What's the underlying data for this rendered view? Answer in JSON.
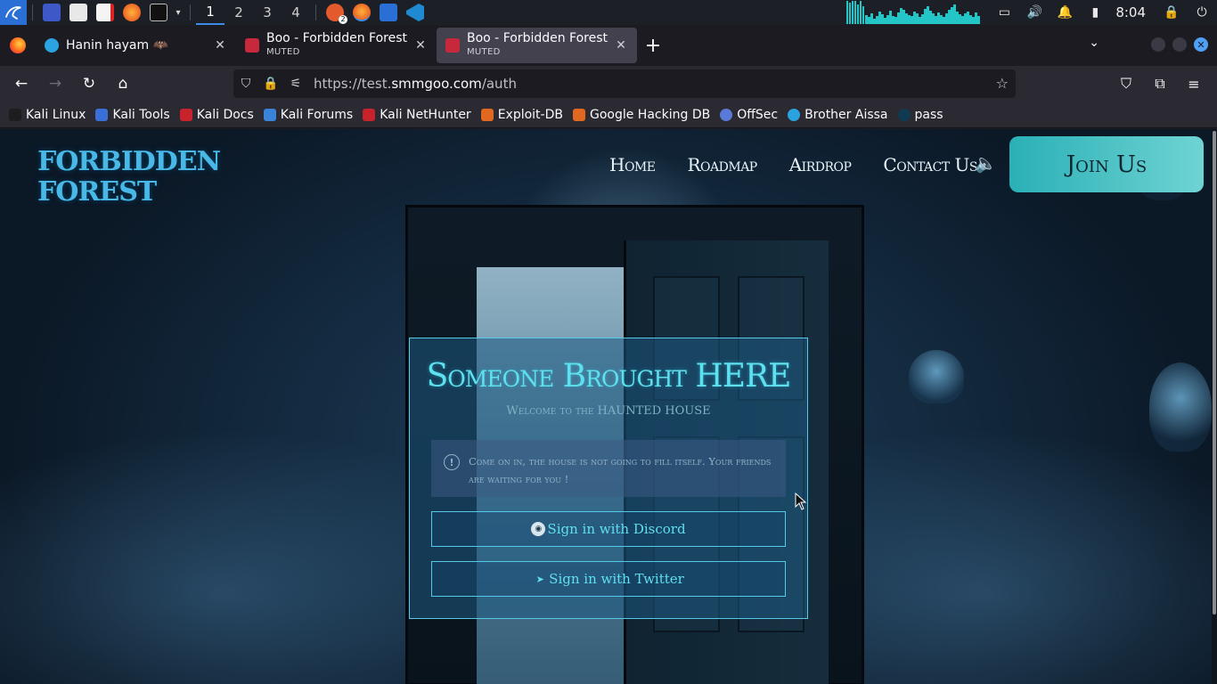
{
  "taskbar": {
    "workspaces": [
      "1",
      "2",
      "3",
      "4"
    ],
    "clock": "8:04",
    "badge": "2"
  },
  "browser": {
    "tabs": [
      {
        "title": "Hanin hayam 🦇",
        "subtitle": ""
      },
      {
        "title": "Boo - Forbidden Forest",
        "subtitle": "MUTED"
      },
      {
        "title": "Boo - Forbidden Forest",
        "subtitle": "MUTED"
      }
    ],
    "url_prefix": "https://test.",
    "url_domain": "smmgoo.com",
    "url_path": "/auth",
    "bookmarks": [
      "Kali Linux",
      "Kali Tools",
      "Kali Docs",
      "Kali Forums",
      "Kali NetHunter",
      "Exploit-DB",
      "Google Hacking DB",
      "OffSec",
      "Brother Aissa",
      "pass"
    ]
  },
  "site": {
    "logo_line1": "FORBIDDEN",
    "logo_line2": "FOREST",
    "nav": [
      "Home",
      "Roadmap",
      "Airdrop",
      "Contact Us"
    ],
    "join_label": "Join Us",
    "card": {
      "title": "Someone Brought HERE",
      "subtitle": "Welcome to the HAUNTED HOUSE",
      "alert": "Come on in, the house is not going to fill itself. Your friends are waiting for you !",
      "discord_label": "Sign in with Discord",
      "twitter_label": "Sign in with Twitter"
    }
  },
  "colors": {
    "accent": "#5fe0ee",
    "join_gradient_start": "#2ab0b6",
    "taskbar": "#1c1f26",
    "tab_active": "#42414d"
  }
}
